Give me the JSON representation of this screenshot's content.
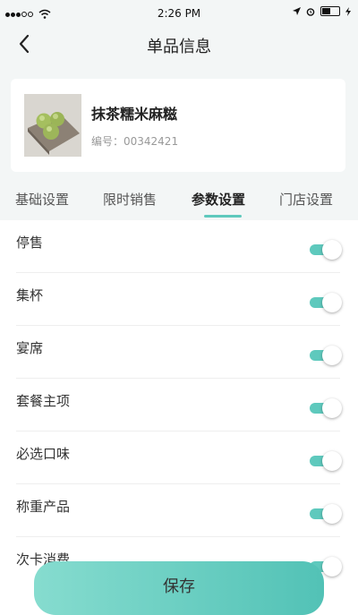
{
  "status_bar": {
    "time": "2:26 PM"
  },
  "nav": {
    "title": "单品信息",
    "back_icon": "chevron-left-icon"
  },
  "product": {
    "name": "抹茶糯米麻糍",
    "code": "编号：00342421"
  },
  "tabs": [
    {
      "label": "基础设置",
      "active": false
    },
    {
      "label": "限时销售",
      "active": false
    },
    {
      "label": "参数设置",
      "active": true
    },
    {
      "label": "门店设置",
      "active": false
    }
  ],
  "settings": [
    {
      "label": "停售",
      "on": true
    },
    {
      "label": "集杯",
      "on": true
    },
    {
      "label": "宴席",
      "on": true
    },
    {
      "label": "套餐主项",
      "on": true
    },
    {
      "label": "必选口味",
      "on": true
    },
    {
      "label": "称重产品",
      "on": true
    },
    {
      "label": "次卡消费",
      "on": true
    }
  ],
  "save_button": {
    "label": "保存"
  },
  "colors": {
    "accent": "#5ec9bd",
    "header_bg": "#f3f6f6"
  }
}
